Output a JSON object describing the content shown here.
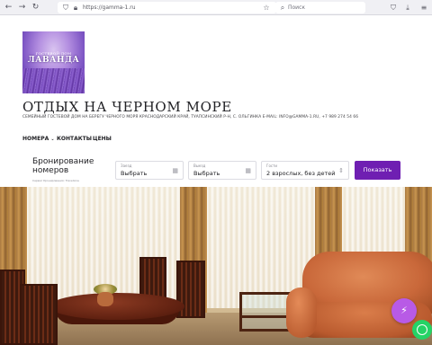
{
  "browser": {
    "url": "https://gamma-1.ru",
    "search_placeholder": "Поиск"
  },
  "logo": {
    "small_text": "ГОСТЕВОЙ ДОМ",
    "big_text": "ЛАВАНДА"
  },
  "site": {
    "title": "ОТДЫХ НА ЧЕРНОМ МОРЕ",
    "subtitle": "СЕМЕЙНЫЙ ГОСТЕВОЙ ДОМ НА БЕРЕГУ ЧЕРНОГО МОРЯ КРАСНОДАРСКИЙ КРАЙ, ТУАПСИНСКИЙ Р-Н, С. ОЛЬГИНКА E-MAIL: INFO@GAMMA-1.RU, +7 989 274 54 66"
  },
  "menu": {
    "items": [
      {
        "label": "НОМЕРА",
        "has_dropdown": true
      },
      {
        "label": "КОНТАКТЫ",
        "has_dropdown": false
      },
      {
        "label": "ЦЕНЫ",
        "has_dropdown": false
      }
    ]
  },
  "booking": {
    "title": "Бронирование номеров",
    "caption": "Сервис бронирования: TravelLine",
    "checkin": {
      "label": "Заезд",
      "value": "Выбрать",
      "icon": "calendar-icon"
    },
    "checkout": {
      "label": "Выезд",
      "value": "Выбрать",
      "icon": "calendar-icon"
    },
    "guests": {
      "label": "Гости",
      "value": "2 взрослых, без детей",
      "icon": "updown-icon"
    },
    "submit_label": "Показать"
  },
  "floating": {
    "action_icon": "lightning-icon",
    "whatsapp_icon": "whatsapp-icon"
  },
  "colors": {
    "accent": "#6f1fb2",
    "fab": "#b85ae6",
    "whatsapp": "#25d366"
  }
}
